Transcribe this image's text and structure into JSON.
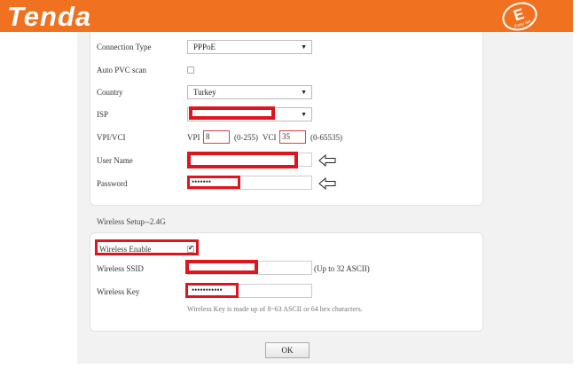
{
  "header": {
    "brand": "Tenda",
    "badge_letter": "E",
    "badge_sub": "Easy set"
  },
  "wan": {
    "connection_type": {
      "label": "Connection Type",
      "value": "PPPoE"
    },
    "auto_pvc": {
      "label": "Auto PVC scan",
      "checked": false
    },
    "country": {
      "label": "Country",
      "value": "Turkey"
    },
    "isp": {
      "label": "ISP",
      "value": ""
    },
    "vpi_vci": {
      "label": "VPI/VCI",
      "vpi_label": "VPI",
      "vpi_value": "8",
      "vpi_range": "(0-255)",
      "vci_label": "VCI",
      "vci_value": "35",
      "vci_range": "(0-65535)"
    },
    "username": {
      "label": "User Name",
      "value": ""
    },
    "password": {
      "label": "Password",
      "value": "•••••••"
    }
  },
  "wireless": {
    "section_title": "Wireless Setup--2.4G",
    "enable": {
      "label": "Wireless Enable",
      "checked": true
    },
    "ssid": {
      "label": "Wireless SSID",
      "value": "",
      "hint": "(Up to 32 ASCII)"
    },
    "key": {
      "label": "Wireless Key",
      "value": "•••••••••••",
      "hint": "Wireless Key is made up of 8~63 ASCII or 64 hex characters."
    }
  },
  "actions": {
    "ok_label": "OK"
  },
  "colors": {
    "header": "#f07120",
    "highlight": "#e0141d",
    "panel_bg": "#f2f2f2"
  },
  "icons": {
    "annotation_arrow": "left-arrow-icon",
    "dropdown": "chevron-down-icon",
    "checkmark": "check-icon"
  }
}
